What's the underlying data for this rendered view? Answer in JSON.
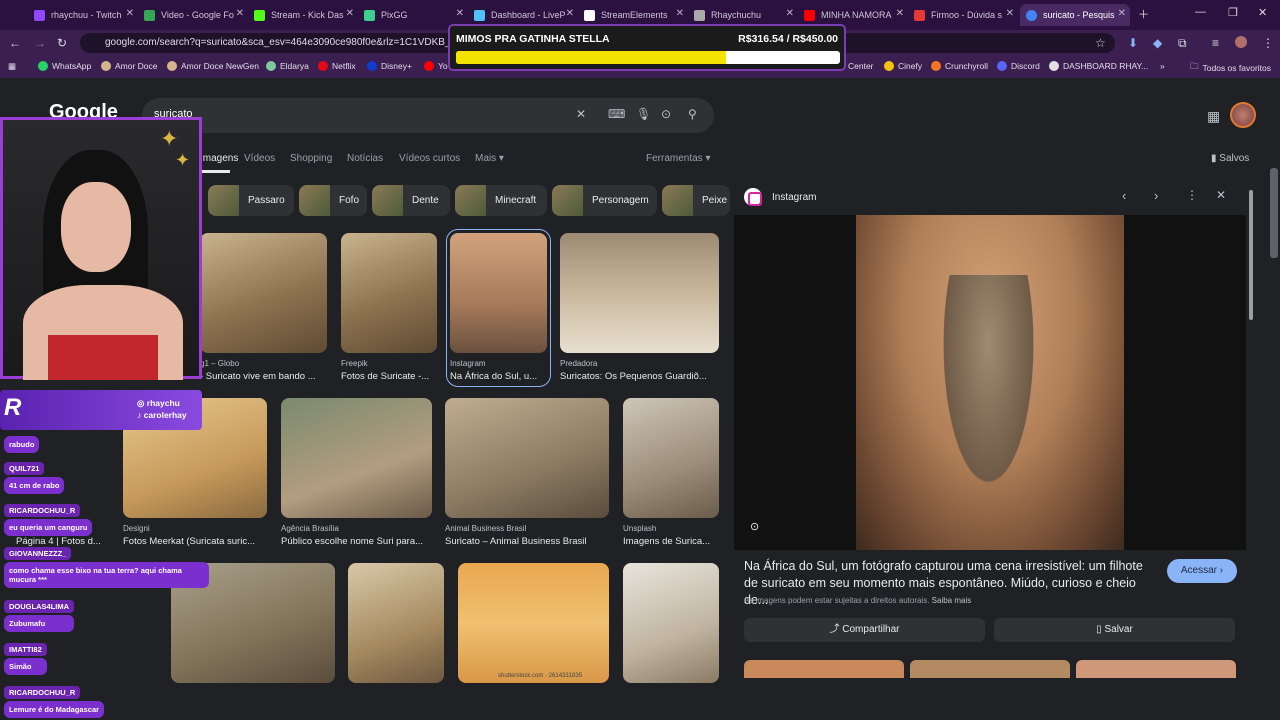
{
  "tabs": [
    {
      "label": "rhaychuu - Twitch",
      "color": "#9146ff"
    },
    {
      "label": "Video - Google Fo",
      "color": "#34a853"
    },
    {
      "label": "Stream - Kick Das",
      "color": "#53fc18"
    },
    {
      "label": "PixGG",
      "color": "#3ecf8e"
    },
    {
      "label": "Dashboard - LiveP",
      "color": "#4fc3f7"
    },
    {
      "label": "StreamElements",
      "color": "#ffffff"
    },
    {
      "label": "Rhaychuchu",
      "color": "#aaaaaa"
    },
    {
      "label": "MINHA NAMORA",
      "color": "#ff0000"
    },
    {
      "label": "Firmoo - Dúvida s",
      "color": "#e53935"
    },
    {
      "label": "suricato - Pesquis",
      "color": "#4285f4"
    }
  ],
  "url": "google.com/search?q=suricato&sca_esv=464e3090ce980f0e&rlz=1C1VDKB_pt-PTP...3A1773286845977&ei=vTWyadauO7LW1sQPx6GxyQ4&...",
  "bookmarks": [
    {
      "label": "WhatsApp",
      "color": "#25d366"
    },
    {
      "label": "Amor Doce",
      "color": "#d7b58a"
    },
    {
      "label": "Amor Doce NewGen",
      "color": "#d7b58a"
    },
    {
      "label": "Eldarya",
      "color": "#7ec8a0"
    },
    {
      "label": "Netflix",
      "color": "#e50914"
    },
    {
      "label": "Disney+",
      "color": "#113ccf"
    },
    {
      "label": "Yo",
      "color": "#ff0000"
    },
    {
      "label": "Center",
      "color": "#9aa0a6"
    },
    {
      "label": "Cinefy",
      "color": "#f4c20d"
    },
    {
      "label": "Crunchyroll",
      "color": "#f47521"
    },
    {
      "label": "Discord",
      "color": "#5865f2"
    },
    {
      "label": "DASHBOARD RHAY...",
      "color": "#e0e0e0"
    }
  ],
  "all_bookmarks": "Todos os favoritos",
  "google": {
    "logo": "Google",
    "query": "suricato",
    "tabs": [
      "Imagens",
      "Vídeos",
      "Shopping",
      "Notícias",
      "Vídeos curtos",
      "Mais"
    ],
    "tools": "Ferramentas",
    "saved": "Salvos",
    "chips": [
      "Passaro",
      "Fofo",
      "Dente",
      "Minecraft",
      "Personagem",
      "Peixe"
    ],
    "row1": [
      {
        "src": "g1 – Globo",
        "title": "- Suricato vive em bando ..."
      },
      {
        "src": "Freepik",
        "title": "Fotos de Suricate -..."
      },
      {
        "src": "Instagram",
        "title": "Na África do Sul, u..."
      },
      {
        "src": "Predadora",
        "title": "Suricatos: Os Pequenos Guardiõ..."
      }
    ],
    "row2": [
      {
        "src": "",
        "title": "Página 4 | Fotos d..."
      },
      {
        "src": "Designi",
        "title": "Fotos Meerkat (Suricata suric..."
      },
      {
        "src": "Agência Brasília",
        "title": "Público escolhe nome Suri para..."
      },
      {
        "src": "Animal Business Brasil",
        "title": "Suricato – Animal Business Brasil"
      },
      {
        "src": "Unsplash",
        "title": "Imagens de Surica..."
      }
    ],
    "watermark": "shutterstock.com · 2614331835"
  },
  "panel": {
    "source": "Instagram",
    "description": "Na África do Sul, um fotógrafo capturou uma cena irresistível: um filhote de suricato em seu momento mais espontâneo. Miúdo, curioso e cheio de...",
    "copyright": "As imagens podem estar sujeitas a direitos autorais.",
    "learn_more": "Saiba mais",
    "visit": "Acessar",
    "share": "Compartilhar",
    "save": "Salvar"
  },
  "donation": {
    "title": "MIMOS PRA GATINHA STELLA",
    "amount": "R$316.54 / R$450.00",
    "progress": 0.7034
  },
  "social": {
    "instagram": "rhaychu",
    "tiktok": "carolerhay"
  },
  "chat": [
    {
      "user": "",
      "msg": "rabudo"
    },
    {
      "user": "QUIL721",
      "msg": "41 cm de rabo"
    },
    {
      "user": "RICARDOCHUU_R",
      "msg": "eu queria um canguru"
    },
    {
      "user": "GIOVANNEZZZ_",
      "msg": "como chama esse bixo na tua terra? aqui chama mucura ***"
    },
    {
      "user": "DOUGLAS4LIMA",
      "msg": "Zubumafu"
    },
    {
      "user": "IMATTI82",
      "msg": "Simão"
    },
    {
      "user": "RICARDOCHUU_R",
      "msg": "Lemure é do Madagascar"
    }
  ]
}
